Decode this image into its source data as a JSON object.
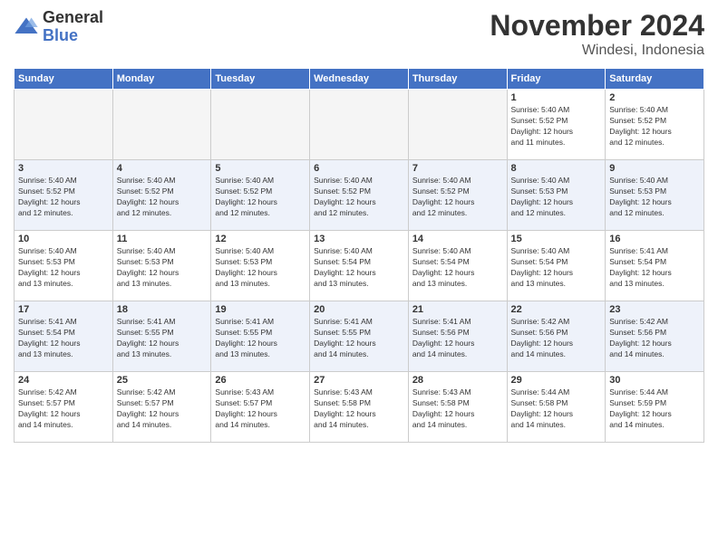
{
  "header": {
    "logo_general": "General",
    "logo_blue": "Blue",
    "month_title": "November 2024",
    "location": "Windesi, Indonesia"
  },
  "days_of_week": [
    "Sunday",
    "Monday",
    "Tuesday",
    "Wednesday",
    "Thursday",
    "Friday",
    "Saturday"
  ],
  "weeks": [
    [
      {
        "day": "",
        "info": ""
      },
      {
        "day": "",
        "info": ""
      },
      {
        "day": "",
        "info": ""
      },
      {
        "day": "",
        "info": ""
      },
      {
        "day": "",
        "info": ""
      },
      {
        "day": "1",
        "info": "Sunrise: 5:40 AM\nSunset: 5:52 PM\nDaylight: 12 hours\nand 11 minutes."
      },
      {
        "day": "2",
        "info": "Sunrise: 5:40 AM\nSunset: 5:52 PM\nDaylight: 12 hours\nand 12 minutes."
      }
    ],
    [
      {
        "day": "3",
        "info": "Sunrise: 5:40 AM\nSunset: 5:52 PM\nDaylight: 12 hours\nand 12 minutes."
      },
      {
        "day": "4",
        "info": "Sunrise: 5:40 AM\nSunset: 5:52 PM\nDaylight: 12 hours\nand 12 minutes."
      },
      {
        "day": "5",
        "info": "Sunrise: 5:40 AM\nSunset: 5:52 PM\nDaylight: 12 hours\nand 12 minutes."
      },
      {
        "day": "6",
        "info": "Sunrise: 5:40 AM\nSunset: 5:52 PM\nDaylight: 12 hours\nand 12 minutes."
      },
      {
        "day": "7",
        "info": "Sunrise: 5:40 AM\nSunset: 5:52 PM\nDaylight: 12 hours\nand 12 minutes."
      },
      {
        "day": "8",
        "info": "Sunrise: 5:40 AM\nSunset: 5:53 PM\nDaylight: 12 hours\nand 12 minutes."
      },
      {
        "day": "9",
        "info": "Sunrise: 5:40 AM\nSunset: 5:53 PM\nDaylight: 12 hours\nand 12 minutes."
      }
    ],
    [
      {
        "day": "10",
        "info": "Sunrise: 5:40 AM\nSunset: 5:53 PM\nDaylight: 12 hours\nand 13 minutes."
      },
      {
        "day": "11",
        "info": "Sunrise: 5:40 AM\nSunset: 5:53 PM\nDaylight: 12 hours\nand 13 minutes."
      },
      {
        "day": "12",
        "info": "Sunrise: 5:40 AM\nSunset: 5:53 PM\nDaylight: 12 hours\nand 13 minutes."
      },
      {
        "day": "13",
        "info": "Sunrise: 5:40 AM\nSunset: 5:54 PM\nDaylight: 12 hours\nand 13 minutes."
      },
      {
        "day": "14",
        "info": "Sunrise: 5:40 AM\nSunset: 5:54 PM\nDaylight: 12 hours\nand 13 minutes."
      },
      {
        "day": "15",
        "info": "Sunrise: 5:40 AM\nSunset: 5:54 PM\nDaylight: 12 hours\nand 13 minutes."
      },
      {
        "day": "16",
        "info": "Sunrise: 5:41 AM\nSunset: 5:54 PM\nDaylight: 12 hours\nand 13 minutes."
      }
    ],
    [
      {
        "day": "17",
        "info": "Sunrise: 5:41 AM\nSunset: 5:54 PM\nDaylight: 12 hours\nand 13 minutes."
      },
      {
        "day": "18",
        "info": "Sunrise: 5:41 AM\nSunset: 5:55 PM\nDaylight: 12 hours\nand 13 minutes."
      },
      {
        "day": "19",
        "info": "Sunrise: 5:41 AM\nSunset: 5:55 PM\nDaylight: 12 hours\nand 13 minutes."
      },
      {
        "day": "20",
        "info": "Sunrise: 5:41 AM\nSunset: 5:55 PM\nDaylight: 12 hours\nand 14 minutes."
      },
      {
        "day": "21",
        "info": "Sunrise: 5:41 AM\nSunset: 5:56 PM\nDaylight: 12 hours\nand 14 minutes."
      },
      {
        "day": "22",
        "info": "Sunrise: 5:42 AM\nSunset: 5:56 PM\nDaylight: 12 hours\nand 14 minutes."
      },
      {
        "day": "23",
        "info": "Sunrise: 5:42 AM\nSunset: 5:56 PM\nDaylight: 12 hours\nand 14 minutes."
      }
    ],
    [
      {
        "day": "24",
        "info": "Sunrise: 5:42 AM\nSunset: 5:57 PM\nDaylight: 12 hours\nand 14 minutes."
      },
      {
        "day": "25",
        "info": "Sunrise: 5:42 AM\nSunset: 5:57 PM\nDaylight: 12 hours\nand 14 minutes."
      },
      {
        "day": "26",
        "info": "Sunrise: 5:43 AM\nSunset: 5:57 PM\nDaylight: 12 hours\nand 14 minutes."
      },
      {
        "day": "27",
        "info": "Sunrise: 5:43 AM\nSunset: 5:58 PM\nDaylight: 12 hours\nand 14 minutes."
      },
      {
        "day": "28",
        "info": "Sunrise: 5:43 AM\nSunset: 5:58 PM\nDaylight: 12 hours\nand 14 minutes."
      },
      {
        "day": "29",
        "info": "Sunrise: 5:44 AM\nSunset: 5:58 PM\nDaylight: 12 hours\nand 14 minutes."
      },
      {
        "day": "30",
        "info": "Sunrise: 5:44 AM\nSunset: 5:59 PM\nDaylight: 12 hours\nand 14 minutes."
      }
    ]
  ]
}
